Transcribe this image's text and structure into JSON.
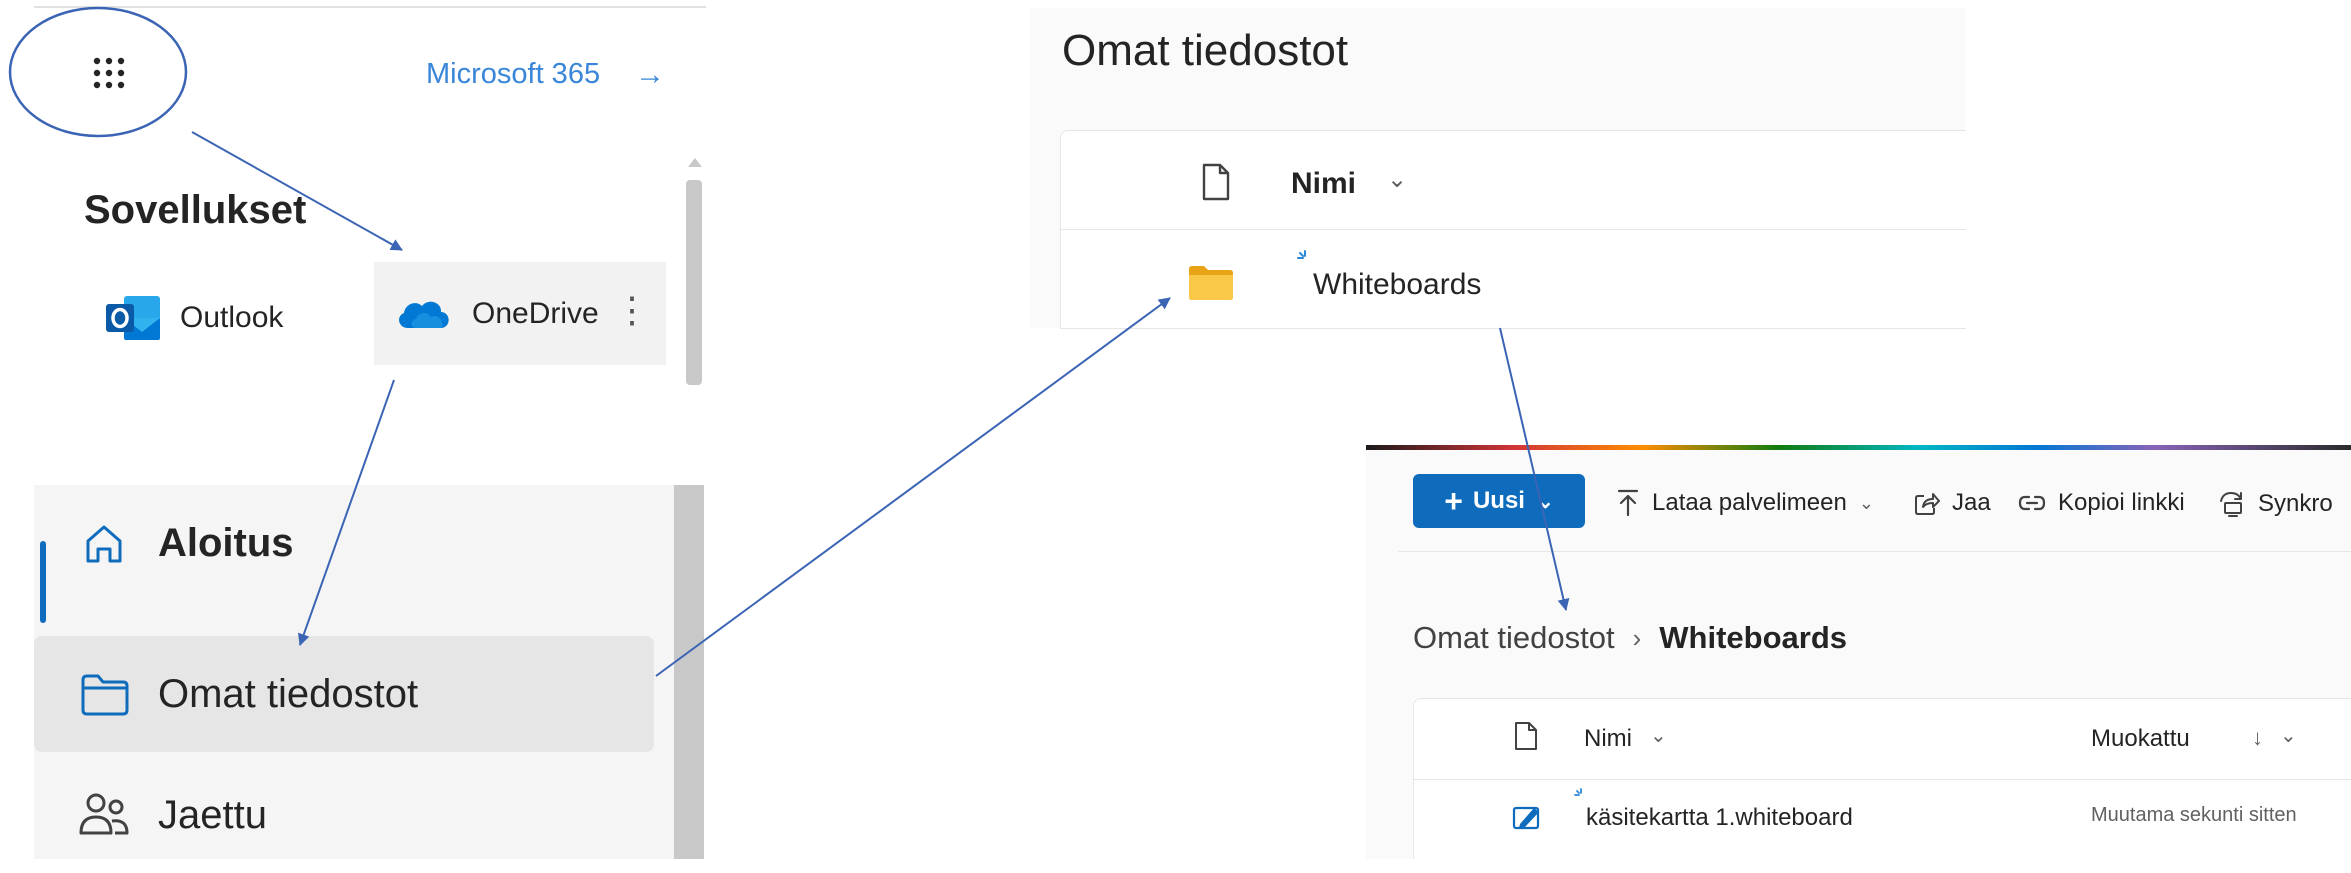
{
  "launcher": {
    "waffle_icon": "app-launcher-waffle-icon",
    "m365_link": "Microsoft 365",
    "m365_arrow": "→",
    "apps_title": "Sovellukset",
    "apps": [
      {
        "label": "Outlook",
        "icon": "outlook-icon"
      },
      {
        "label": "OneDrive",
        "icon": "onedrive-icon",
        "more": "⋮"
      }
    ]
  },
  "nav": {
    "items": [
      {
        "label": "Aloitus",
        "icon": "home-icon",
        "selected": true
      },
      {
        "label": "Omat tiedostot",
        "icon": "folder-icon",
        "hovered": true
      },
      {
        "label": "Jaettu",
        "icon": "people-icon"
      }
    ]
  },
  "my_files": {
    "title": "Omat tiedostot",
    "column_name": "Nimi",
    "rows": [
      {
        "name": "Whiteboards",
        "type": "folder"
      }
    ]
  },
  "whiteboards_folder": {
    "toolbar": {
      "new_label": "Uusi",
      "upload_label": "Lataa palvelimeen",
      "share_label": "Jaa",
      "copy_link_label": "Kopioi linkki",
      "sync_label": "Synkro"
    },
    "breadcrumb": {
      "parent": "Omat tiedostot",
      "separator": "›",
      "current": "Whiteboards"
    },
    "columns": {
      "name": "Nimi",
      "modified": "Muokattu",
      "sort_indicator": "↓"
    },
    "rows": [
      {
        "name": "käsitekartta 1.whiteboard",
        "modified": "Muutama sekunti sitten",
        "type": "whiteboard"
      }
    ]
  },
  "colors": {
    "accent_blue": "#0f6cbd",
    "link_blue": "#3a86d9",
    "annotation_blue": "#3b64b5",
    "folder_yellow": "#f4c430"
  }
}
